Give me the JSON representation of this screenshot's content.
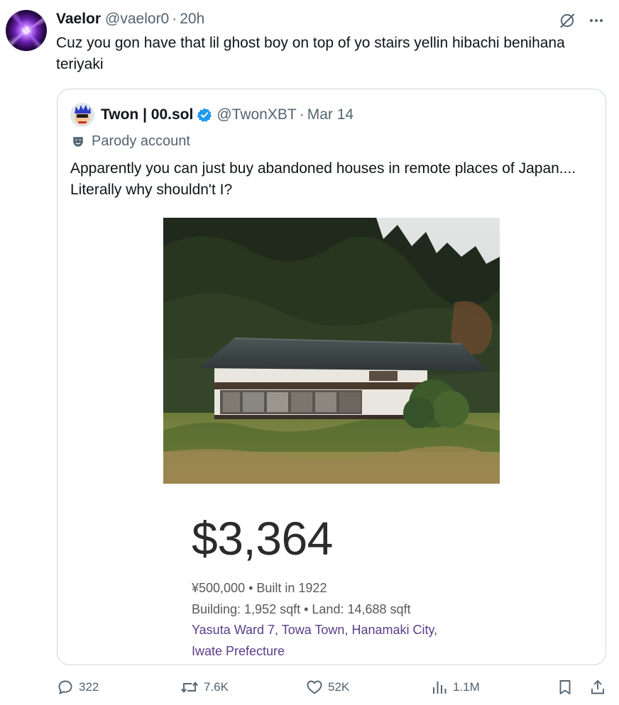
{
  "post": {
    "author_name": "Vaelor",
    "author_handle": "@vaelor0",
    "separator": "·",
    "time": "20h",
    "text": "Cuz you gon have that lil ghost boy on top of yo stairs yellin hibachi benihana teriyaki",
    "icons": [
      "grok-icon",
      "more-icon"
    ]
  },
  "quote": {
    "author_name": "Twon | 00.sol",
    "verified": true,
    "author_handle": "@TwonXBT",
    "separator": "·",
    "date": "Mar 14",
    "label": "Parody account",
    "text": "Apparently you can just buy abandoned houses in remote places of Japan.... Literally why shouldn't I?",
    "listing": {
      "price": "$3,364",
      "line1": "¥500,000 • Built in 1922",
      "line2": "Building: 1,952 sqft • Land: 14,688 sqft",
      "address_line1": "Yasuta Ward 7, Towa Town, Hanamaki City,",
      "address_line2": "Iwate Prefecture"
    }
  },
  "actions": {
    "replies": "322",
    "reposts": "7.6K",
    "likes": "52K",
    "views": "1.1M"
  },
  "colors": {
    "text": "#0f1419",
    "secondary": "#536471",
    "border": "#cfd9de",
    "verified": "#1d9bf0",
    "address": "#5b3d8a"
  }
}
